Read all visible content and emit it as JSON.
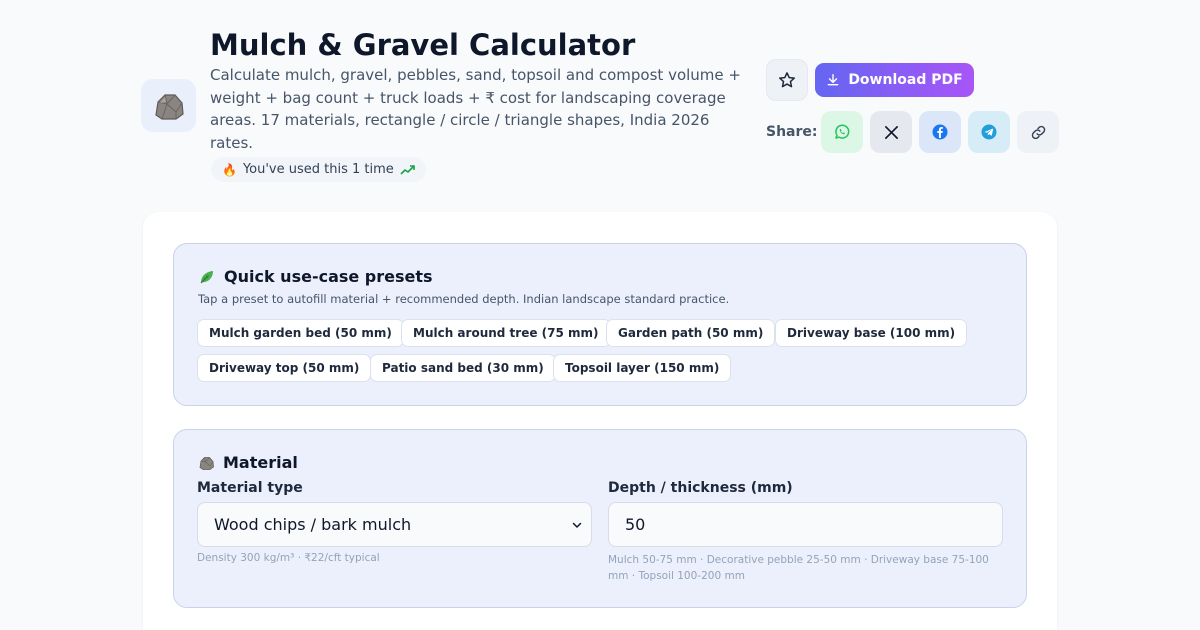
{
  "header": {
    "title": "Mulch & Gravel Calculator",
    "subtitle": "Calculate mulch, gravel, pebbles, sand, topsoil and compost volume + weight + bag count + truck loads + ₹ cost for landscaping coverage areas. 17 materials, rectangle / circle / triangle shapes, India 2026 rates.",
    "usage_text": "You've used this 1 time",
    "app_icon": "rock-icon"
  },
  "actions": {
    "favorite_icon": "star-icon",
    "download_label": "Download PDF",
    "share_label": "Share:",
    "share_targets": [
      "whatsapp",
      "x",
      "facebook",
      "telegram",
      "copy-link"
    ]
  },
  "presets": {
    "title": "Quick use-case presets",
    "description": "Tap a preset to autofill material + recommended depth. Indian landscape standard practice.",
    "items": [
      "Mulch garden bed (50 mm)",
      "Mulch around tree (75 mm)",
      "Garden path (50 mm)",
      "Driveway base (100 mm)",
      "Driveway top (50 mm)",
      "Patio sand bed (30 mm)",
      "Topsoil layer (150 mm)"
    ]
  },
  "material": {
    "title": "Material",
    "type_label": "Material type",
    "type_value": "Wood chips / bark mulch",
    "type_hint": "Density 300 kg/m³ · ₹22/cft typical",
    "depth_label": "Depth / thickness (mm)",
    "depth_value": "50",
    "depth_hint_line1": "Mulch 50-75 mm · Decorative pebble 25-50 mm · Driveway base 75-100",
    "depth_hint_line2": "mm · Topsoil 100-200 mm"
  },
  "colors": {
    "accent_gradient_start": "#6366f1",
    "accent_gradient_end": "#a855f7",
    "whatsapp": "#22c55e",
    "facebook": "#1877f2",
    "telegram": "#229ed9"
  }
}
